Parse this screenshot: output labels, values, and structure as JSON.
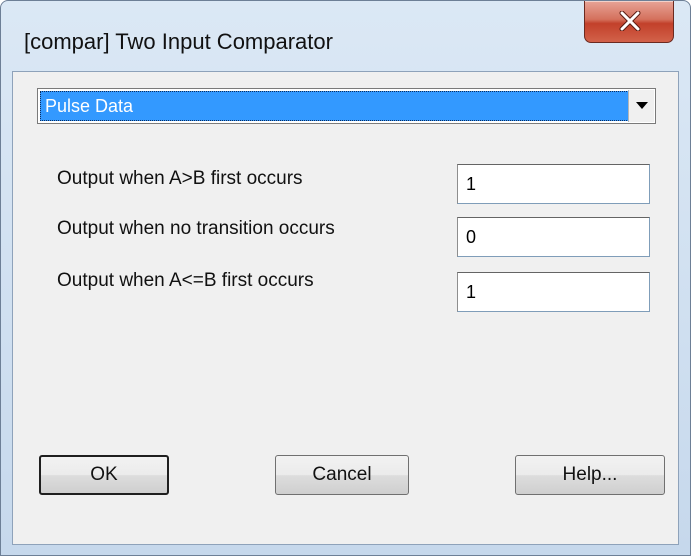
{
  "window": {
    "title": "[compar] Two Input Comparator",
    "close_icon": "close-icon"
  },
  "dropdown": {
    "selected": "Pulse Data",
    "arrow_icon": "chevron-down-icon"
  },
  "fields": [
    {
      "label": "Output when A>B first occurs",
      "value": "1"
    },
    {
      "label": "Output when no transition occurs",
      "value": "0"
    },
    {
      "label": "Output when A<=B first occurs",
      "value": "1"
    }
  ],
  "buttons": {
    "ok": "OK",
    "cancel": "Cancel",
    "help": "Help..."
  },
  "colors": {
    "selection": "#3399ff",
    "close_button": "#c2402a",
    "frame": "#cfdff0"
  }
}
